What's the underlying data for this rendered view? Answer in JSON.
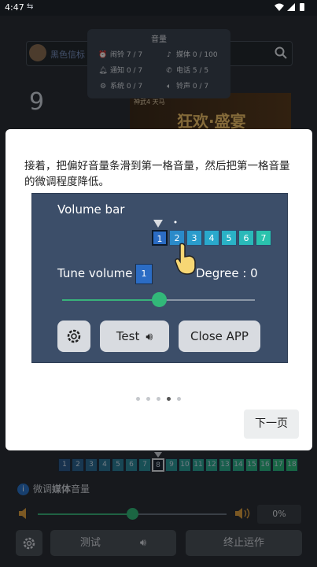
{
  "status_bar": {
    "time": "4:47",
    "aux": "⇆"
  },
  "background": {
    "search_text": "黑色信标",
    "big_number": "9",
    "banner_small": "神武4 天马",
    "banner_text": "狂欢·盛宴",
    "volume_popup": {
      "title": "音量",
      "rows": [
        {
          "label": "闹铃",
          "value": "7 / 7"
        },
        {
          "label": "媒体",
          "value": "0 / 100"
        },
        {
          "label": "通知",
          "value": "0 / 7"
        },
        {
          "label": "电话",
          "value": "5 / 5"
        },
        {
          "label": "系统",
          "value": "0 / 7"
        },
        {
          "label": "铃声",
          "value": "0 / 7"
        }
      ]
    }
  },
  "dialog": {
    "instruction": "接着，把偏好音量条滑到第一格音量，然后把第一格音量的微调程度降低。",
    "demo": {
      "volume_bar_label": "Volume  bar",
      "cells": [
        "1",
        "2",
        "3",
        "4",
        "5",
        "6",
        "7"
      ],
      "tune_label": "Tune volume",
      "tune_value": "1",
      "degree_label": "Degree :  0",
      "slider_value": 0.5,
      "test_label": "Test",
      "close_label": "Close APP"
    },
    "pages": {
      "total": 5,
      "current": 4
    },
    "next_label": "下一页"
  },
  "bottom": {
    "cells": [
      "1",
      "2",
      "3",
      "4",
      "5",
      "6",
      "7",
      "8",
      "9",
      "10",
      "11",
      "12",
      "13",
      "14",
      "15",
      "16",
      "17",
      "18"
    ],
    "selected_cell": "8",
    "info_prefix": "微调",
    "info_bold": "媒体",
    "info_suffix": "音量",
    "slider_value": 0.5,
    "percent": "0%",
    "test_label": "测试",
    "stop_label": "终止运作"
  },
  "colors": {
    "accent_green": "#32b879",
    "cell_blue": "#2b6cc4",
    "dialog_bg": "#ffffff"
  }
}
